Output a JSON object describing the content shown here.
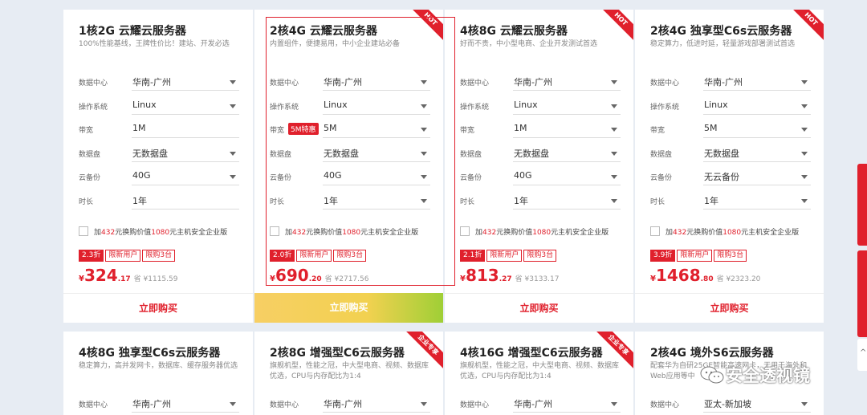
{
  "row1": [
    {
      "title": "1核2G 云耀云服务器",
      "subtitle": "100%性能基线，王牌性价比！建站、开发必选",
      "ribbon": "",
      "fields": [
        {
          "label": "数据中心",
          "value": "华南-广州",
          "dropdown": true,
          "promo": ""
        },
        {
          "label": "操作系统",
          "value": "Linux",
          "dropdown": true,
          "promo": ""
        },
        {
          "label": "带宽",
          "value": "1M",
          "dropdown": false,
          "promo": ""
        },
        {
          "label": "数据盘",
          "value": "无数据盘",
          "dropdown": true,
          "promo": ""
        },
        {
          "label": "云备份",
          "value": "40G",
          "dropdown": true,
          "promo": ""
        },
        {
          "label": "时长",
          "value": "1年",
          "dropdown": false,
          "promo": ""
        }
      ],
      "addon": {
        "pre": "加",
        "a": "432",
        "mid": "元换购价值",
        "b": "1080",
        "post": "元主机安全企业版"
      },
      "tags": [
        "2.3折",
        "限新用户",
        "限购3台"
      ],
      "price": {
        "currency": "¥",
        "int": "324",
        "dec": ".17",
        "orig": "省 ¥1115.59"
      },
      "buy": "立即购买"
    },
    {
      "title": "2核4G 云耀云服务器",
      "subtitle": "内置组件，便捷易用，中小企业建站必备",
      "ribbon": "HOT",
      "fields": [
        {
          "label": "数据中心",
          "value": "华南-广州",
          "dropdown": true,
          "promo": ""
        },
        {
          "label": "操作系统",
          "value": "Linux",
          "dropdown": true,
          "promo": ""
        },
        {
          "label": "带宽",
          "value": "5M",
          "dropdown": true,
          "promo": "5M特惠"
        },
        {
          "label": "数据盘",
          "value": "无数据盘",
          "dropdown": true,
          "promo": ""
        },
        {
          "label": "云备份",
          "value": "40G",
          "dropdown": true,
          "promo": ""
        },
        {
          "label": "时长",
          "value": "1年",
          "dropdown": true,
          "promo": ""
        }
      ],
      "addon": {
        "pre": "加",
        "a": "432",
        "mid": "元换购价值",
        "b": "1080",
        "post": "元主机安全企业版"
      },
      "tags": [
        "2.0折",
        "限新用户",
        "限购3台"
      ],
      "price": {
        "currency": "¥",
        "int": "690",
        "dec": ".20",
        "orig": "省 ¥2717.56"
      },
      "buy": "立即购买"
    },
    {
      "title": "4核8G 云耀云服务器",
      "subtitle": "好而不贵，中小型电商、企业开发测试首选",
      "ribbon": "HOT",
      "fields": [
        {
          "label": "数据中心",
          "value": "华南-广州",
          "dropdown": true,
          "promo": ""
        },
        {
          "label": "操作系统",
          "value": "Linux",
          "dropdown": true,
          "promo": ""
        },
        {
          "label": "带宽",
          "value": "1M",
          "dropdown": true,
          "promo": ""
        },
        {
          "label": "数据盘",
          "value": "无数据盘",
          "dropdown": true,
          "promo": ""
        },
        {
          "label": "云备份",
          "value": "40G",
          "dropdown": true,
          "promo": ""
        },
        {
          "label": "时长",
          "value": "1年",
          "dropdown": true,
          "promo": ""
        }
      ],
      "addon": {
        "pre": "加",
        "a": "432",
        "mid": "元换购价值",
        "b": "1080",
        "post": "元主机安全企业版"
      },
      "tags": [
        "2.1折",
        "限新用户",
        "限购3台"
      ],
      "price": {
        "currency": "¥",
        "int": "813",
        "dec": ".27",
        "orig": "省 ¥3133.17"
      },
      "buy": "立即购买"
    },
    {
      "title": "2核4G 独享型C6s云服务器",
      "subtitle": "稳定算力，低进时延，轻量游戏部署测试首选",
      "ribbon": "HOT",
      "fields": [
        {
          "label": "数据中心",
          "value": "华南-广州",
          "dropdown": true,
          "promo": ""
        },
        {
          "label": "操作系统",
          "value": "Linux",
          "dropdown": true,
          "promo": ""
        },
        {
          "label": "带宽",
          "value": "5M",
          "dropdown": true,
          "promo": ""
        },
        {
          "label": "数据盘",
          "value": "无数据盘",
          "dropdown": true,
          "promo": ""
        },
        {
          "label": "云备份",
          "value": "无云备份",
          "dropdown": true,
          "promo": ""
        },
        {
          "label": "时长",
          "value": "1年",
          "dropdown": true,
          "promo": ""
        }
      ],
      "addon": {
        "pre": "加",
        "a": "432",
        "mid": "元换购价值",
        "b": "1080",
        "post": "元主机安全企业版"
      },
      "tags": [
        "3.9折",
        "限新用户",
        "限购3台"
      ],
      "price": {
        "currency": "¥",
        "int": "1468",
        "dec": ".80",
        "orig": "省 ¥2323.20"
      },
      "buy": "立即购买"
    }
  ],
  "row2": [
    {
      "title": "4核8G 独享型C6s云服务器",
      "subtitle": "稳定算力，高并发网卡，数据库、缓存服务器优选",
      "ribbon": "",
      "field": {
        "label": "数据中心",
        "value": "华南-广州"
      }
    },
    {
      "title": "2核8G 增强型C6云服务器",
      "subtitle": "旗舰机型，性能之冠，中大型电商、视频、数据库优选，CPU与内存配比为1:4",
      "ribbon": "企业专享",
      "field": {
        "label": "数据中心",
        "value": "华南-广州"
      }
    },
    {
      "title": "4核16G 增强型C6云服务器",
      "subtitle": "旗舰机型，性能之冠，中大型电商、视频、数据库优选，CPU与内存配比为1:4",
      "ribbon": "企业专享",
      "field": {
        "label": "数据中心",
        "value": "华南-广州"
      }
    },
    {
      "title": "2核4G 境外S6云服务器",
      "subtitle": "配套华为自研25GE智能高速网卡，无用于海外和Web应用等中",
      "ribbon": "",
      "field": {
        "label": "数据中心",
        "value": "亚太-新加坡"
      }
    }
  ],
  "watermark": "安全透视镜",
  "colors": {
    "accent": "#e0202c",
    "background": "#e7ecf3"
  }
}
